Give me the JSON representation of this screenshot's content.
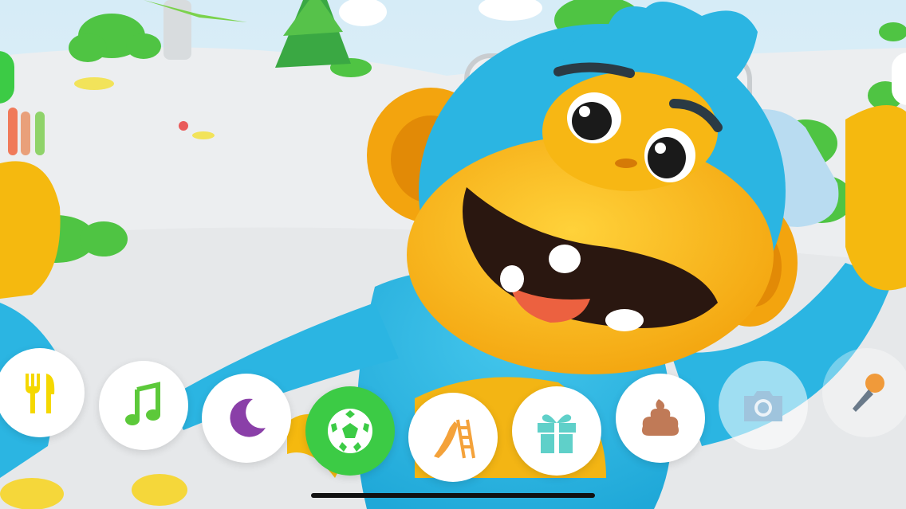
{
  "app": {
    "scene_character": "blue-orange-monkey",
    "active_action": "play-ball"
  },
  "colors": {
    "active_button": "#3ccb45",
    "food": "#f5d800",
    "music": "#5cc93a",
    "sleep": "#8a3fa8",
    "play": "#3ccb45",
    "slide": "#f4a23a",
    "gift": "#5fd0c9",
    "poop": "#c07a57",
    "camera": "#9fc4dd",
    "microphone": "#f09a3a"
  },
  "actions": [
    {
      "id": "food",
      "icon": "fork-knife-icon",
      "state": "normal"
    },
    {
      "id": "music",
      "icon": "music-note-icon",
      "state": "normal"
    },
    {
      "id": "sleep",
      "icon": "moon-icon",
      "state": "normal"
    },
    {
      "id": "play",
      "icon": "soccer-ball-icon",
      "state": "active"
    },
    {
      "id": "slide",
      "icon": "slide-icon",
      "state": "normal"
    },
    {
      "id": "gift",
      "icon": "gift-icon",
      "state": "normal"
    },
    {
      "id": "poop",
      "icon": "poop-icon",
      "state": "normal"
    },
    {
      "id": "camera",
      "icon": "camera-icon",
      "state": "disabled"
    },
    {
      "id": "microphone",
      "icon": "microphone-icon",
      "state": "translucent"
    }
  ]
}
